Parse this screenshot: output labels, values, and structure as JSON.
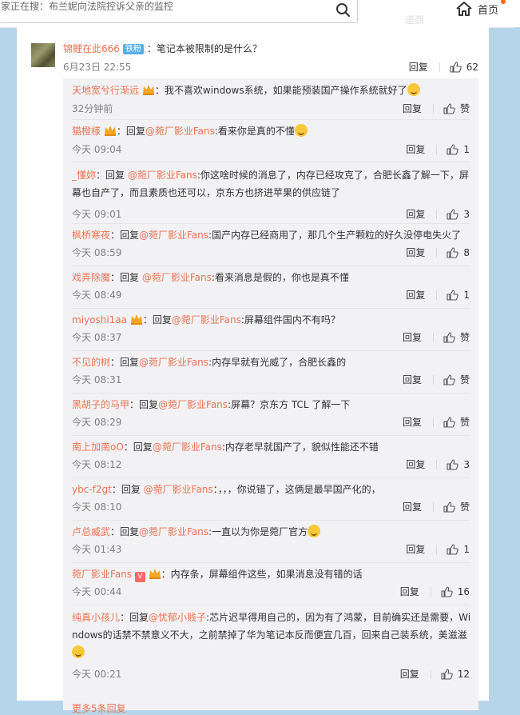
{
  "header": {
    "search_text": "家正在搜：布兰妮向法院控诉父亲的监控",
    "home_label": "首页",
    "ghost_label": "道西"
  },
  "main_comment": {
    "username": "锦鲤在此666",
    "badge": "铁粉",
    "text": "：笔记本被限制的是什么？",
    "time": "6月23日 22:55",
    "reply_label": "回复",
    "likes": "62"
  },
  "replies": [
    {
      "user": "天地宽兮行渐远",
      "pre": "",
      "mention": "",
      "text": "：我不喜欢windows系统，如果能预装国产操作系统就好了",
      "time": "32分钟前",
      "reply_label": "回复",
      "likes": "赞",
      "crown": true,
      "emoji": true
    },
    {
      "user": "猫橙様",
      "pre": "：回复",
      "mention": "@菀厂影业Fans",
      "text": ":看来你是真的不懂",
      "time": "今天 09:04",
      "reply_label": "回复",
      "likes": "1",
      "crown": true,
      "emoji": true
    },
    {
      "user": "_懂妳",
      "pre": "：回复 ",
      "mention": "@菀厂影业Fans",
      "text": ":你这啥时候的消息了，内存已经攻克了，合肥长鑫了解一下，屏幕也自产了，而且素质也还可以，京东方也挤进苹果的供应链了",
      "time": "今天 09:01",
      "reply_label": "回复",
      "likes": "3"
    },
    {
      "user": "枫桥寒夜",
      "pre": "：回复",
      "mention": "@菀厂影业Fans",
      "text": ":国产内存已经商用了，那几个生产颗粒的好久没停电失火了",
      "time": "今天 08:59",
      "reply_label": "回复",
      "likes": "8"
    },
    {
      "user": "戏弄除魔",
      "pre": "：回复 ",
      "mention": "@菀厂影业Fans",
      "text": ":看来消息是假的，你也是真不懂",
      "time": "今天 08:49",
      "reply_label": "回复",
      "likes": "1"
    },
    {
      "user": "miyoshi1aa",
      "pre": "：回复",
      "mention": "@菀厂影业Fans",
      "text": ":屏幕组件国内不有吗？",
      "time": "今天 08:37",
      "reply_label": "回复",
      "likes": "赞",
      "crown": true
    },
    {
      "user": "不见的树",
      "pre": "：回复",
      "mention": "@菀厂影业Fans",
      "text": ":内存早就有光威了，合肥长鑫的",
      "time": "今天 08:31",
      "reply_label": "回复",
      "likes": "赞"
    },
    {
      "user": "黑胡子的马甲",
      "pre": "：回复",
      "mention": "@菀厂影业Fans",
      "text": ":屏幕？京东方 TCL 了解一下",
      "time": "今天 08:29",
      "reply_label": "回复",
      "likes": "赞"
    },
    {
      "user": "南上加南oO",
      "pre": "：回复",
      "mention": "@菀厂影业Fans",
      "text": ":内存老早就国产了，貌似性能还不错",
      "time": "今天 08:12",
      "reply_label": "回复",
      "likes": "3"
    },
    {
      "user": "ybc-f2gt",
      "pre": "：回复 ",
      "mention": "@菀厂影业Fans",
      "text": "：，，，你说错了，这俩是最早国产化的，",
      "time": "今天 08:10",
      "reply_label": "回复",
      "likes": "赞"
    },
    {
      "user": "卢总威武",
      "pre": "：回复",
      "mention": "@菀厂影业Fans",
      "text": ":一直以为你是菀厂官方",
      "time": "今天 01:43",
      "reply_label": "回复",
      "likes": "1",
      "emoji": true
    },
    {
      "user": "菀厂影业Fans",
      "pre": "",
      "mention": "",
      "text": "：内存条，屏幕组件这些，如果消息没有错的话",
      "time": "今天 00:44",
      "reply_label": "回复",
      "likes": "16",
      "vbadge": "V",
      "crown": true
    },
    {
      "user": "纯真小孩儿",
      "pre": "：回复",
      "mention": "@忧郁小贱子",
      "text": ":芯片迟早得用自己的，因为有了鸿蒙，目前确实还是需要，Windows的话禁不禁意义不大，之前禁掉了华为笔记本反而便宜几百，回来自己装系统，美滋滋",
      "time": "今天 00:21",
      "reply_label": "回复",
      "likes": "12",
      "emoji": true
    }
  ],
  "more_link": "更多5条回复"
}
